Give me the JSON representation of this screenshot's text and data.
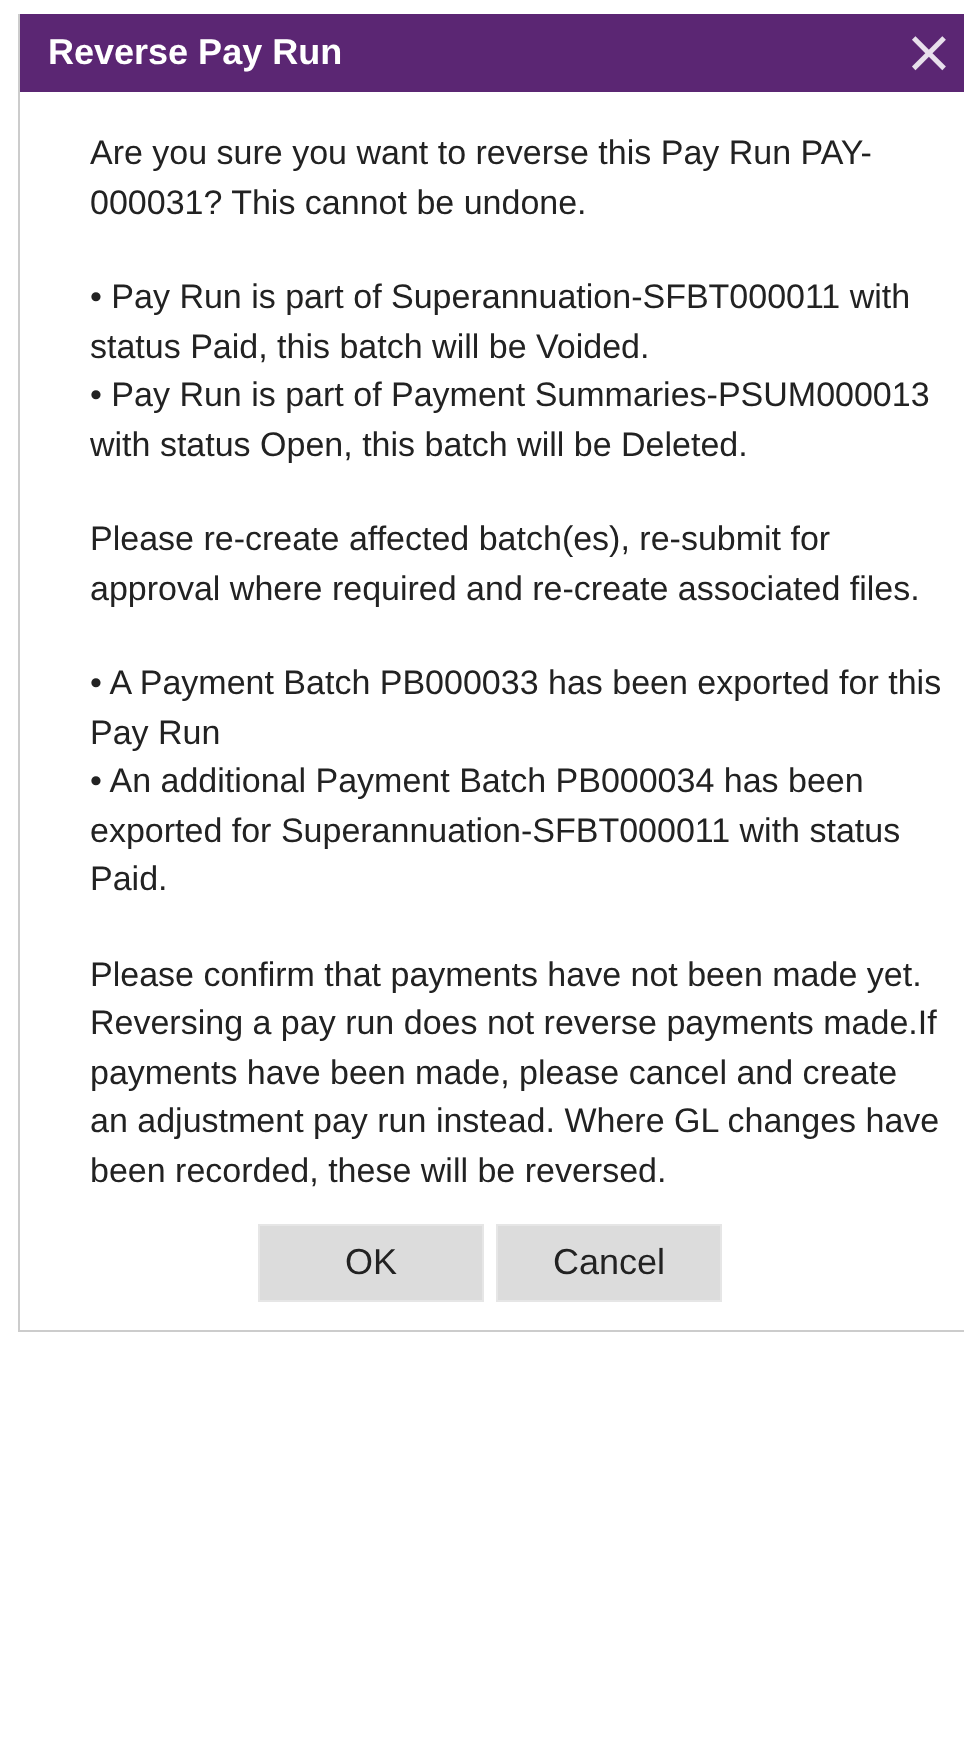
{
  "window": {
    "title": "Reverse Pay Run",
    "close": "×"
  },
  "paragraphs": [
    {
      "lines": [
        "Are you sure you want to reverse this Pay Run PAY-000031? This cannot be undone."
      ]
    },
    {
      "lines": [
        "• Pay Run is part of Superannuation-SFBT000011 with status Paid, this batch will be Voided.",
        "• Pay Run is part of Payment Summaries-PSUM000013 with status Open, this batch will be Deleted."
      ]
    },
    {
      "lines": [
        "Please re-create affected batch(es), re-submit for approval where required and re-create associated files."
      ]
    },
    {
      "lines": [
        "• A Payment Batch PB000033 has been exported for this Pay Run",
        "• An additional Payment Batch PB000034 has been exported for Superannuation-SFBT000011 with status Paid."
      ]
    },
    {
      "lines": [
        "Please confirm that payments have not been made yet. Reversing a pay run does not reverse payments made.If payments have been made, please cancel and create an adjustment pay run instead. Where GL changes have been recorded, these will be reversed."
      ]
    }
  ],
  "buttons": [
    "OK",
    "Cancel"
  ]
}
